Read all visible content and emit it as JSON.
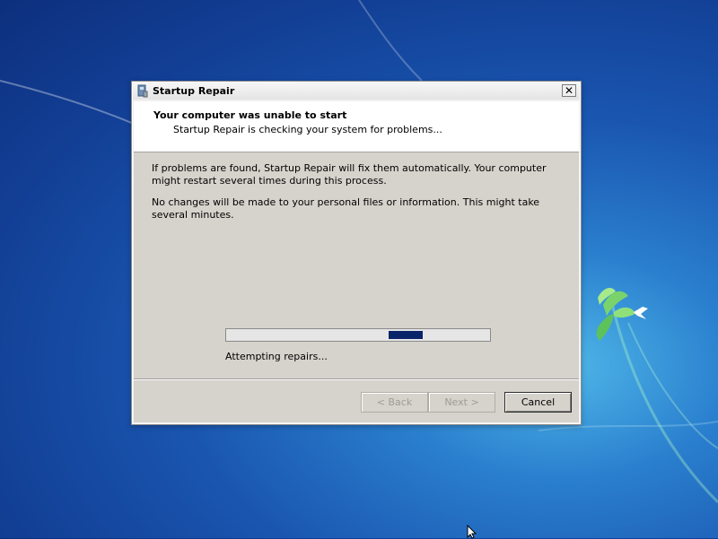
{
  "window": {
    "title": "Startup Repair",
    "close_glyph": "✕"
  },
  "header": {
    "title": "Your computer was unable to start",
    "subtitle": "Startup Repair is checking your system for problems..."
  },
  "body": {
    "paragraph1": "If problems are found, Startup Repair will fix them automatically. Your computer might restart several times during this process.",
    "paragraph2": "No changes will be made to your personal files or information. This might take several minutes.",
    "status": "Attempting repairs...",
    "progress_marquee_position": 0.71
  },
  "buttons": {
    "back": "< Back",
    "next": "Next >",
    "cancel": "Cancel"
  },
  "colors": {
    "progress_fill": "#0a246a",
    "desktop_blue": "#1a56b0",
    "window_body": "#d6d3cc"
  },
  "icons": {
    "window_icon": "startup-repair-icon",
    "close": "close-icon",
    "wallpaper_logo": "windows-leaf-bird-icon",
    "cursor": "mouse-cursor-icon"
  }
}
